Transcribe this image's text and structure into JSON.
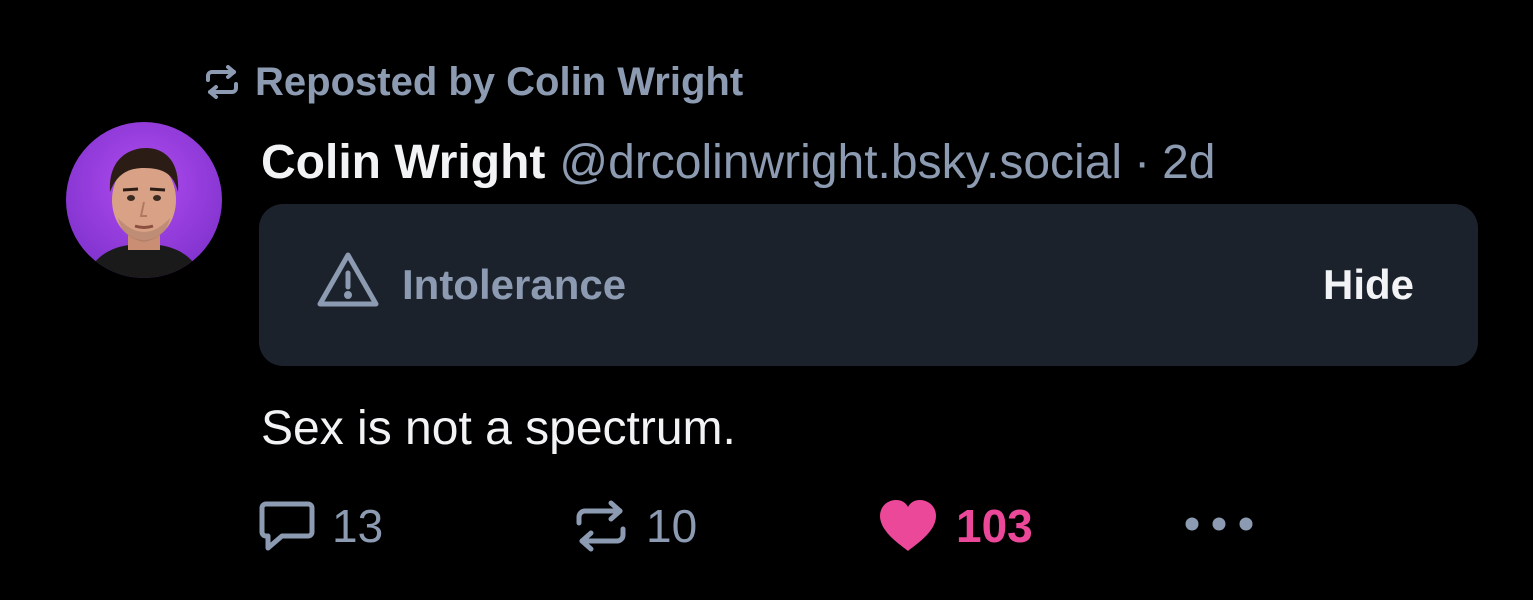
{
  "repost": {
    "label": "Reposted by Colin Wright",
    "icon": "repost-icon"
  },
  "post": {
    "author_name": "Colin Wright",
    "author_handle": "@drcolinwright.bsky.social",
    "separator": "·",
    "time": "2d",
    "avatar_color": "#8b3fd9",
    "text": "Sex is not a spectrum."
  },
  "content_warning": {
    "icon": "warning-icon",
    "label": "Intolerance",
    "hide_label": "Hide"
  },
  "actions": {
    "reply_count": "13",
    "repost_count": "10",
    "like_count": "103",
    "like_color": "#ec4899",
    "more_icon": "more-icon"
  },
  "colors": {
    "background": "#000000",
    "muted": "#8c9bb1",
    "text": "#f1f3f5",
    "warning_box": "#1c222b"
  }
}
